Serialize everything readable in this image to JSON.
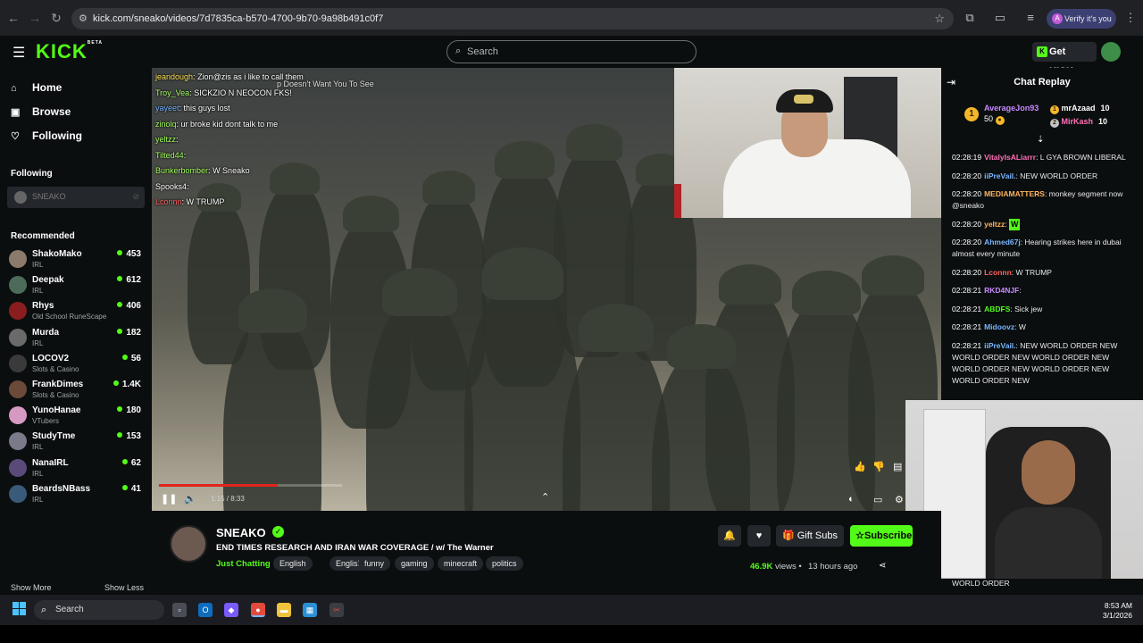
{
  "browser": {
    "url": "kick.com/sneako/videos/7d7835ca-b570-4700-9b70-9a98b491c0f7",
    "verify_label": "Verify it's you",
    "verify_initial": "A"
  },
  "header": {
    "logo": "KICK",
    "logo_beta": "BETA",
    "search_placeholder": "Search",
    "get_kicks": "Get KICKs"
  },
  "sidebar": {
    "nav": [
      {
        "label": "Home",
        "icon": "home-icon"
      },
      {
        "label": "Browse",
        "icon": "browse-icon"
      },
      {
        "label": "Following",
        "icon": "heart-icon"
      }
    ],
    "following_heading": "Following",
    "following_channel": "SNEAKO",
    "recommended_heading": "Recommended",
    "recommended": [
      {
        "name": "ShakoMako",
        "category": "IRL",
        "viewers": "453",
        "color": "#8c7b6b"
      },
      {
        "name": "Deepak",
        "category": "IRL",
        "viewers": "612",
        "color": "#4d6b5a"
      },
      {
        "name": "Rhys",
        "category": "Old School RuneScape",
        "viewers": "406",
        "color": "#8a1e1e"
      },
      {
        "name": "Murda",
        "category": "IRL",
        "viewers": "182",
        "color": "#6a6a6a"
      },
      {
        "name": "LOCOV2",
        "category": "Slots & Casino",
        "viewers": "56",
        "color": "#3a3a3a"
      },
      {
        "name": "FrankDimes",
        "category": "Slots & Casino",
        "viewers": "1.4K",
        "color": "#6b4a3a"
      },
      {
        "name": "YunoHanae",
        "category": "VTubers",
        "viewers": "180",
        "color": "#d69ac2"
      },
      {
        "name": "StudyTme",
        "category": "IRL",
        "viewers": "153",
        "color": "#7a7a8a"
      },
      {
        "name": "NanaIRL",
        "category": "IRL",
        "viewers": "62",
        "color": "#5a4a7a"
      },
      {
        "name": "BeardsNBass",
        "category": "IRL",
        "viewers": "41",
        "color": "#3a5a7a"
      }
    ],
    "show_more": "Show More",
    "show_less": "Show Less"
  },
  "video": {
    "overlay_chat": [
      {
        "user": "jeandough",
        "text": "Zion@zis as i like to call them",
        "color": "u-yellow"
      },
      {
        "user": "Troy_Vea",
        "text": "SICKZIO N NEOCON FKS!",
        "color": "u-green"
      },
      {
        "user": "yayeet",
        "text": "this guys lost",
        "color": "u-blue"
      },
      {
        "user": "zinolq",
        "text": "ur broke kid dont talk to me",
        "color": "u-green"
      },
      {
        "user": "yeltzz",
        "text": "",
        "color": "u-green"
      },
      {
        "user": "Tilted44",
        "text": "",
        "color": "u-green"
      },
      {
        "user": "Bunkerbomber",
        "text": "W Sneako",
        "color": "u-green"
      },
      {
        "user": "Spooks4",
        "text": "",
        "color": "u-white"
      },
      {
        "user": "Lconnn",
        "text": "W TRUMP",
        "color": "u-red"
      }
    ],
    "overlay_ticker": "p Doesn't Want You To See",
    "timecode": "1:15 / 8:33",
    "progress": 0.65
  },
  "stream": {
    "channel": "SNEAKO",
    "title": "END TIMES RESEARCH AND IRAN WAR COVERAGE / w/ The Warner",
    "category": "Just Chatting",
    "tags": [
      "English",
      "English",
      "funny",
      "gaming",
      "minecraft",
      "politics"
    ],
    "gift_subs": "Gift Subs",
    "subscribe": "Subscribe",
    "views": "46.9K",
    "views_label": "views",
    "ago": "13 hours ago"
  },
  "chat": {
    "title": "Chat Replay",
    "pinned": {
      "top_user": "AverageJon93",
      "top_value": "50",
      "others": [
        {
          "rank": "1",
          "user": "mrAzaad",
          "count": "10"
        },
        {
          "rank": "2",
          "user": "MirKash",
          "count": "10"
        }
      ]
    },
    "messages": [
      {
        "ts": "02:28:19",
        "user": "VitalyIsALiarrr",
        "color": "#ff6fb5",
        "text": "L GYA BROWN LIBERAL"
      },
      {
        "ts": "02:28:20",
        "user": "iiPreVail.",
        "color": "#77b5ff",
        "text": "NEW WORLD ORDER"
      },
      {
        "ts": "02:28:20",
        "user": "MEDIAMATTERS",
        "color": "#ffb45c",
        "text": "monkey segment now @sneako"
      },
      {
        "ts": "02:28:20",
        "user": "yeltzz",
        "color": "#ffb45c",
        "text": "W"
      },
      {
        "ts": "02:28:20",
        "user": "Ahmed67j",
        "color": "#77b5ff",
        "text": "Hearing strikes here in dubai almost every minute"
      },
      {
        "ts": "02:28:20",
        "user": "Lconnn",
        "color": "#ff6262",
        "text": "W TRUMP"
      },
      {
        "ts": "02:28:21",
        "user": "RKD4NJF",
        "color": "#c78aff",
        "text": ""
      },
      {
        "ts": "02:28:21",
        "user": "ABDFS",
        "color": "#53fc18",
        "text": "Sick jew"
      },
      {
        "ts": "02:28:21",
        "user": "Midoovz",
        "color": "#77b5ff",
        "text": "W"
      },
      {
        "ts": "02:28:21",
        "user": "iiPreVail.",
        "color": "#77b5ff",
        "text": "NEW WORLD ORDER NEW WORLD ORDER NEW WORLD ORDER NEW WORLD ORDER NEW WORLD ORDER NEW WORLD ORDER NEW"
      }
    ],
    "trailing": "WORLD ORDER"
  },
  "taskbar": {
    "search": "Search",
    "time": "8:53 AM",
    "date": "3/1/2026"
  }
}
